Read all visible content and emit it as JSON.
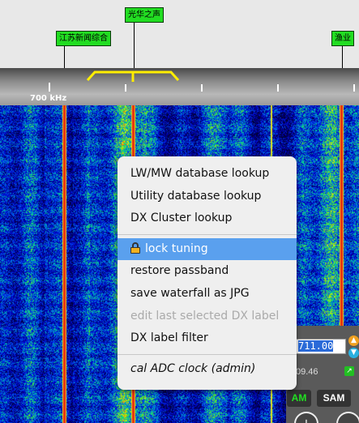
{
  "dx_labels": [
    {
      "name": "江苏新闻综合"
    },
    {
      "name": "光华之声"
    },
    {
      "name": "渔业"
    }
  ],
  "scale": {
    "label": "700 kHz"
  },
  "panel": {
    "frequency_value": "711.00",
    "small_freq": "09.46",
    "mode_am": "AM",
    "mode_sam": "SAM",
    "link_icon": "external-link-icon"
  },
  "menu": {
    "items": [
      {
        "label": "LW/MW database lookup"
      },
      {
        "label": "Utility database lookup"
      },
      {
        "label": "DX Cluster lookup"
      },
      {
        "label": "lock tuning"
      },
      {
        "label": "restore passband"
      },
      {
        "label": "save waterfall as JPG"
      },
      {
        "label": "edit last selected DX label"
      },
      {
        "label": "DX label filter"
      },
      {
        "label": "cal ADC clock (admin)"
      }
    ]
  },
  "colors": {
    "dx_label": "#22dd22",
    "passband": "#ffee00",
    "menu_highlight": "#5aa0ee",
    "mode_am_active": "#22e022"
  }
}
